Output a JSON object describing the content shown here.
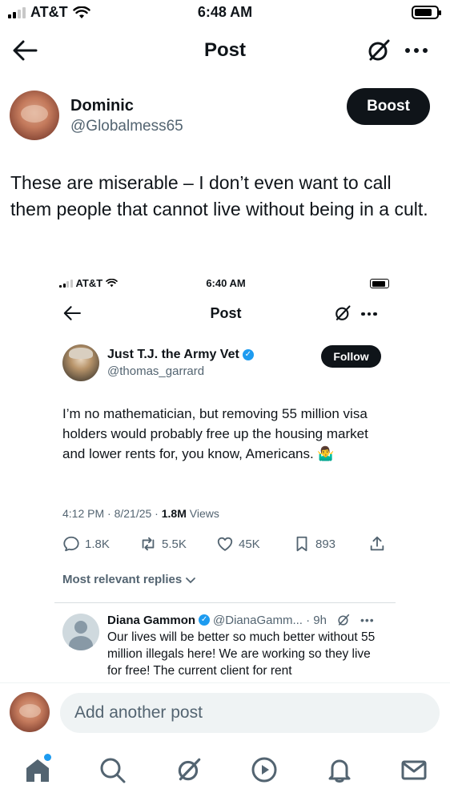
{
  "status_bar": {
    "carrier": "AT&T",
    "time": "6:48 AM"
  },
  "header": {
    "title": "Post"
  },
  "post": {
    "author_name": "Dominic",
    "author_handle": "@Globalmess65",
    "boost_label": "Boost",
    "text": "These are miserable – I don’t even want to call them people that cannot live without being in a cult."
  },
  "embedded": {
    "status_bar": {
      "carrier": "AT&T",
      "time": "6:40 AM"
    },
    "header": {
      "title": "Post"
    },
    "author_name": "Just T.J. the Army Vet",
    "author_handle": "@thomas_garrard",
    "follow_label": "Follow",
    "text": "I’m no mathematician, but removing 55 million visa holders would probably free up the housing market and lower rents for, you know, Americans. 🤷‍♂️",
    "meta_time": "4:12 PM · 8/21/25 · ",
    "meta_views_count": "1.8M",
    "meta_views_label": " Views",
    "stats": {
      "replies": "1.8K",
      "reposts": "5.5K",
      "likes": "45K",
      "bookmarks": "893"
    },
    "replies_label": "Most relevant replies",
    "reply": {
      "name": "Diana Gammon",
      "handle": "@DianaGamm... · 9h",
      "text": "Our lives will be better so much better without 55 million illegals here! We are working so they live for free! The current client for rent"
    }
  },
  "compose": {
    "placeholder": "Add another post"
  },
  "colors": {
    "accent": "#1d9bf0",
    "text": "#0f1419",
    "secondary": "#536471"
  },
  "tabbar": {
    "items": [
      "home-icon",
      "search-icon",
      "grok-icon",
      "video-icon",
      "bell-icon",
      "mail-icon"
    ]
  }
}
